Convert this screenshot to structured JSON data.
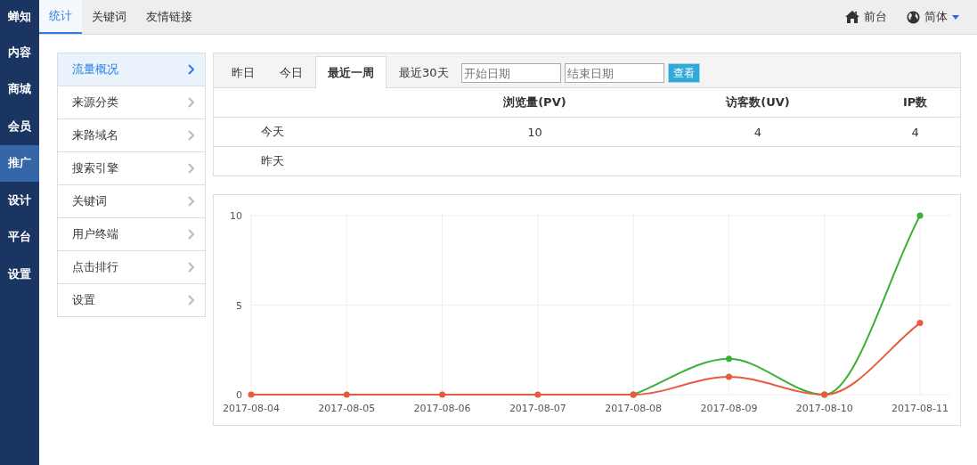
{
  "logo": "蝉知",
  "nav": [
    {
      "label": "内容",
      "kind": "item",
      "selected": false
    },
    {
      "label": "商城",
      "kind": "item",
      "selected": false
    },
    {
      "label": "会员",
      "kind": "item",
      "selected": false
    },
    {
      "label": "推广",
      "kind": "item",
      "selected": true
    },
    {
      "label": "设计",
      "kind": "item",
      "selected": false
    },
    {
      "label": "平台",
      "kind": "item",
      "selected": false
    },
    {
      "label": "设置",
      "kind": "item",
      "selected": false
    }
  ],
  "top_tabs": [
    {
      "label": "统计",
      "selected": true
    },
    {
      "label": "关键词",
      "selected": false
    },
    {
      "label": "友情链接",
      "selected": false
    }
  ],
  "top_links": [
    {
      "label": "前台",
      "kind": "home"
    },
    {
      "label": "简体",
      "kind": "lang"
    }
  ],
  "side_menu": [
    {
      "label": "流量概况",
      "selected": true
    },
    {
      "label": "来源分类",
      "selected": false
    },
    {
      "label": "来路域名",
      "selected": false
    },
    {
      "label": "搜索引擎",
      "selected": false
    },
    {
      "label": "关键词",
      "selected": false
    },
    {
      "label": "用户终端",
      "selected": false
    },
    {
      "label": "点击排行",
      "selected": false
    },
    {
      "label": "设置",
      "selected": false
    }
  ],
  "period_tabs": [
    {
      "label": "昨日",
      "selected": false
    },
    {
      "label": "今日",
      "selected": false
    },
    {
      "label": "最近一周",
      "selected": true
    },
    {
      "label": "最近30天",
      "selected": false
    }
  ],
  "date_fields": [
    {
      "placeholder": "开始日期"
    },
    {
      "placeholder": "结束日期"
    }
  ],
  "view_button": "查看",
  "table": {
    "columns": [
      "",
      "浏览量(PV)",
      "访客数(UV)",
      "IP数"
    ],
    "rows": [
      [
        "今天",
        "10",
        "4",
        "4"
      ],
      [
        "昨天",
        "",
        "",
        ""
      ]
    ]
  },
  "chart_data": {
    "type": "line",
    "categories": [
      "2017-08-04",
      "2017-08-05",
      "2017-08-06",
      "2017-08-07",
      "2017-08-08",
      "2017-08-09",
      "2017-08-10",
      "2017-08-11"
    ],
    "ylim": [
      0,
      10
    ],
    "yticks": [
      0,
      5,
      10
    ],
    "grid": true,
    "series": [
      {
        "color": "#3cb035",
        "marker": true,
        "values": [
          null,
          null,
          null,
          null,
          0,
          2,
          0,
          10
        ]
      },
      {
        "color": "#ea5a3f",
        "marker": true,
        "values": [
          0,
          0,
          0,
          0,
          0,
          1,
          0,
          4
        ]
      }
    ]
  }
}
